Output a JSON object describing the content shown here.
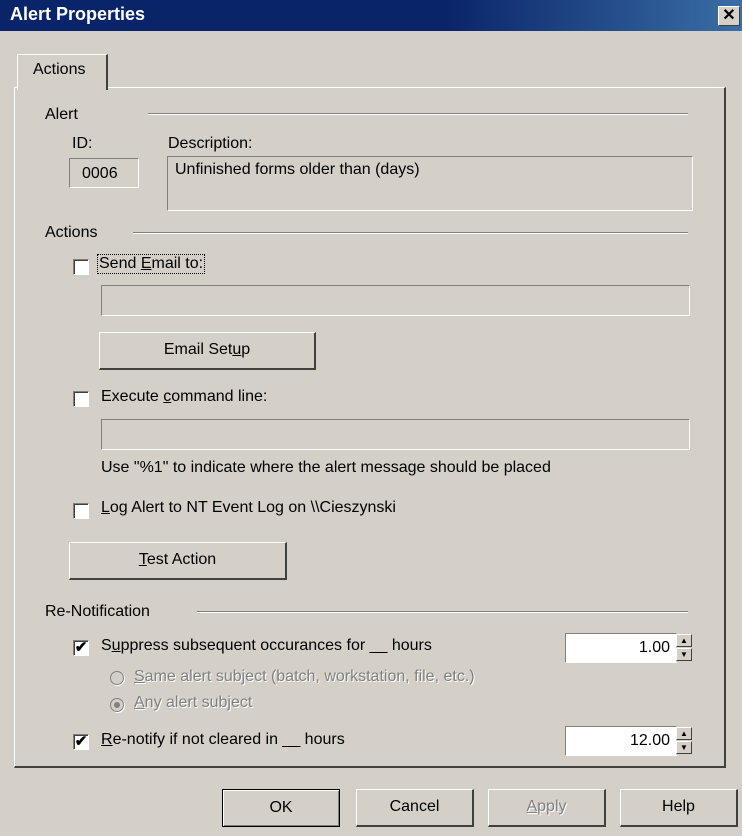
{
  "window": {
    "title": "Alert Properties",
    "close_glyph": "✕"
  },
  "tabs": [
    {
      "label": "Actions"
    }
  ],
  "alert_group": {
    "label": "Alert",
    "id_label": "ID:",
    "id_value": "0006",
    "description_label": "Description:",
    "description_value": "Unfinished forms older than (days)"
  },
  "actions_group": {
    "label": "Actions",
    "send_email": {
      "label_pre": "Send ",
      "label_mnemonic": "E",
      "label_post": "mail to:",
      "checked": false,
      "value": ""
    },
    "email_setup_button": {
      "label_pre": "Email Set",
      "label_mnemonic": "u",
      "label_post": "p"
    },
    "execute_command": {
      "label_pre": "Execute ",
      "label_mnemonic": "c",
      "label_post": "ommand line:",
      "checked": false,
      "value": ""
    },
    "command_hint": "Use \"%1\" to indicate where the alert message should be placed",
    "log_alert": {
      "label_pre": "",
      "label_mnemonic": "L",
      "label_post": "og Alert to NT Event Log on \\\\Cieszynski",
      "checked": false
    },
    "test_action_button": {
      "label_pre": "",
      "label_mnemonic": "T",
      "label_post": "est Action"
    }
  },
  "renotification_group": {
    "label": "Re-Notification",
    "suppress": {
      "label_pre": "S",
      "label_mnemonic": "u",
      "label_post": "ppress subsequent occurances for __ hours",
      "checked": true,
      "check_glyph": "✔",
      "value": "1.00"
    },
    "same_subject": {
      "label_pre": "",
      "label_mnemonic": "S",
      "label_post": "ame alert subject (batch, workstation, file, etc.)",
      "selected": false
    },
    "any_subject": {
      "label_pre": "",
      "label_mnemonic": "A",
      "label_post": "ny alert subject",
      "selected": true
    },
    "renotify": {
      "label_pre": "",
      "label_mnemonic": "R",
      "label_post": "e-notify if not cleared in __ hours",
      "checked": true,
      "check_glyph": "✔",
      "value": "12.00"
    }
  },
  "footer_buttons": {
    "ok": "OK",
    "cancel": "Cancel",
    "apply_pre": "",
    "apply_mnemonic": "A",
    "apply_post": "pply",
    "help": "Help"
  },
  "icons": {
    "spin_up": "▲",
    "spin_down": "▼"
  },
  "colors": {
    "titlebar": "#0a246a",
    "face": "#d4d0c8",
    "disabled_text": "#808080"
  }
}
